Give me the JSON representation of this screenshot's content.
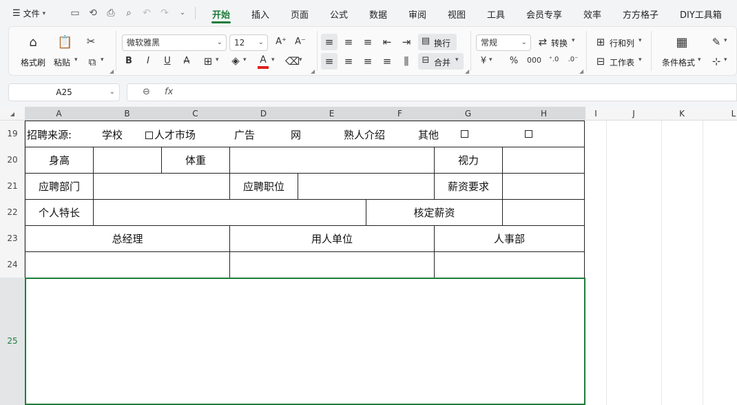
{
  "menubar": {
    "file_label": "文件",
    "tabs": [
      "开始",
      "插入",
      "页面",
      "公式",
      "数据",
      "审阅",
      "视图",
      "工具",
      "会员专享",
      "效率",
      "方方格子",
      "DIY工具箱"
    ],
    "active_tab": "开始"
  },
  "ribbon": {
    "format_painter": "格式刷",
    "paste": "粘贴",
    "font_name": "微软雅黑",
    "font_size": "12",
    "wrap": "换行",
    "merge": "合并",
    "number_format": "常规",
    "convert": "转换",
    "row_col": "行和列",
    "worksheet": "工作表",
    "cond_format": "条件格式",
    "font_color": "#e02020"
  },
  "formula_bar": {
    "cell_ref": "A25",
    "fx": "fx",
    "value": ""
  },
  "columns": [
    "A",
    "B",
    "C",
    "D",
    "E",
    "F",
    "G",
    "H",
    "I",
    "J",
    "K",
    "L"
  ],
  "rows": [
    "19",
    "20",
    "21",
    "22",
    "23",
    "24",
    "25"
  ],
  "sheet": {
    "r19": {
      "label": "招聘来源:",
      "school": "学校",
      "talent": "人才市场",
      "ad": "广告",
      "web": "网",
      "ref": "熟人介绍",
      "other": "其他"
    },
    "r20": {
      "height": "身高",
      "weight": "体重",
      "vision": "视力"
    },
    "r21": {
      "dept": "应聘部门",
      "position": "应聘职位",
      "salary_req": "薪资要求"
    },
    "r22": {
      "skills": "个人特长",
      "salary_fixed": "核定薪资"
    },
    "r23": {
      "gm": "总经理",
      "employer": "用人单位",
      "hr": "人事部"
    }
  },
  "colors": {
    "accent": "#1e7d3a"
  }
}
